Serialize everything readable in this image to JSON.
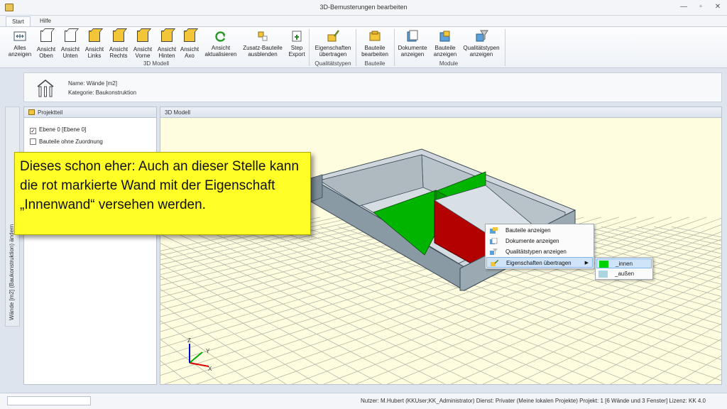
{
  "window": {
    "title": "3D-Bemusterungen bearbeiten"
  },
  "tabs": [
    "Start",
    "Hilfe"
  ],
  "ribbon": {
    "buttons": {
      "alle": "Alles\nanzeigen",
      "oben": "Ansicht\nOben",
      "unten": "Ansicht\nUnten",
      "links": "Ansicht\nLinks",
      "rechts": "Ansicht\nRechts",
      "vorne": "Ansicht\nVorne",
      "hinten": "Ansicht\nHinten",
      "axo": "Ansicht\nAxo",
      "aktualisieren": "Ansicht\naktualisieren",
      "zusatz": "Zusatz-Bauteile\nausblenden",
      "step": "Step\nExport",
      "eig_uebertragen": "Eigenschaften\nübertragen",
      "bauteile_bearbeiten": "Bauteile\nbearbeiten",
      "dokumente": "Dokumente\nanzeigen",
      "bauteile_anzeigen": "Bauteile\nanzeigen",
      "qualitaetstypen": "Qualitätstypen\nanzeigen"
    },
    "groups": {
      "modell": "3D Modell",
      "qualitaet": "Qualitätstypen",
      "bauteile": "Bauteile",
      "module": "Module"
    }
  },
  "info": {
    "name": "Name: Wände [m2]",
    "kategorie": "Kategorie: Baukonstruktion"
  },
  "sidetab": {
    "label": "Wände [m2] (Baukonstruktion) ändern"
  },
  "projektteil": {
    "title": "Projektteil",
    "items": [
      {
        "label": "Ebene 0 [Ebene 0]",
        "checked": "✓"
      },
      {
        "label": "Bauteile ohne Zuordnung",
        "checked": ""
      }
    ]
  },
  "view": {
    "title": "3D Modell",
    "axis_x": "X",
    "axis_y": "Y",
    "axis_z": "Z"
  },
  "callout": {
    "text": "Dieses schon eher: Auch an dieser Stelle kann die rot markierte Wand mit der Eigenschaft „Innenwand“ versehen werden."
  },
  "context_menu": {
    "items": [
      "Bauteile anzeigen",
      "Dokumente anzeigen",
      "Qualitätstypen anzeigen",
      "Eigenschaften übertragen"
    ],
    "highlighted_index": 3,
    "submenu": [
      {
        "label": "_innen",
        "color": "#00d200"
      },
      {
        "label": "_außen",
        "color": "#a9d6e0"
      }
    ]
  },
  "status": {
    "text": "Nutzer: M.Hubert (KKUser;KK_Administrator)   Dienst: Privater (Meine lokalen Projekte)   Projekt: 1 [6 Wände und 3 Fenster]   Lizenz: KK 4.0"
  },
  "colors": {
    "wall_red": "#b30000",
    "wall_green": "#00b400",
    "wall_gray": "#8a9aa4",
    "grid_bg": "#fffde0"
  }
}
